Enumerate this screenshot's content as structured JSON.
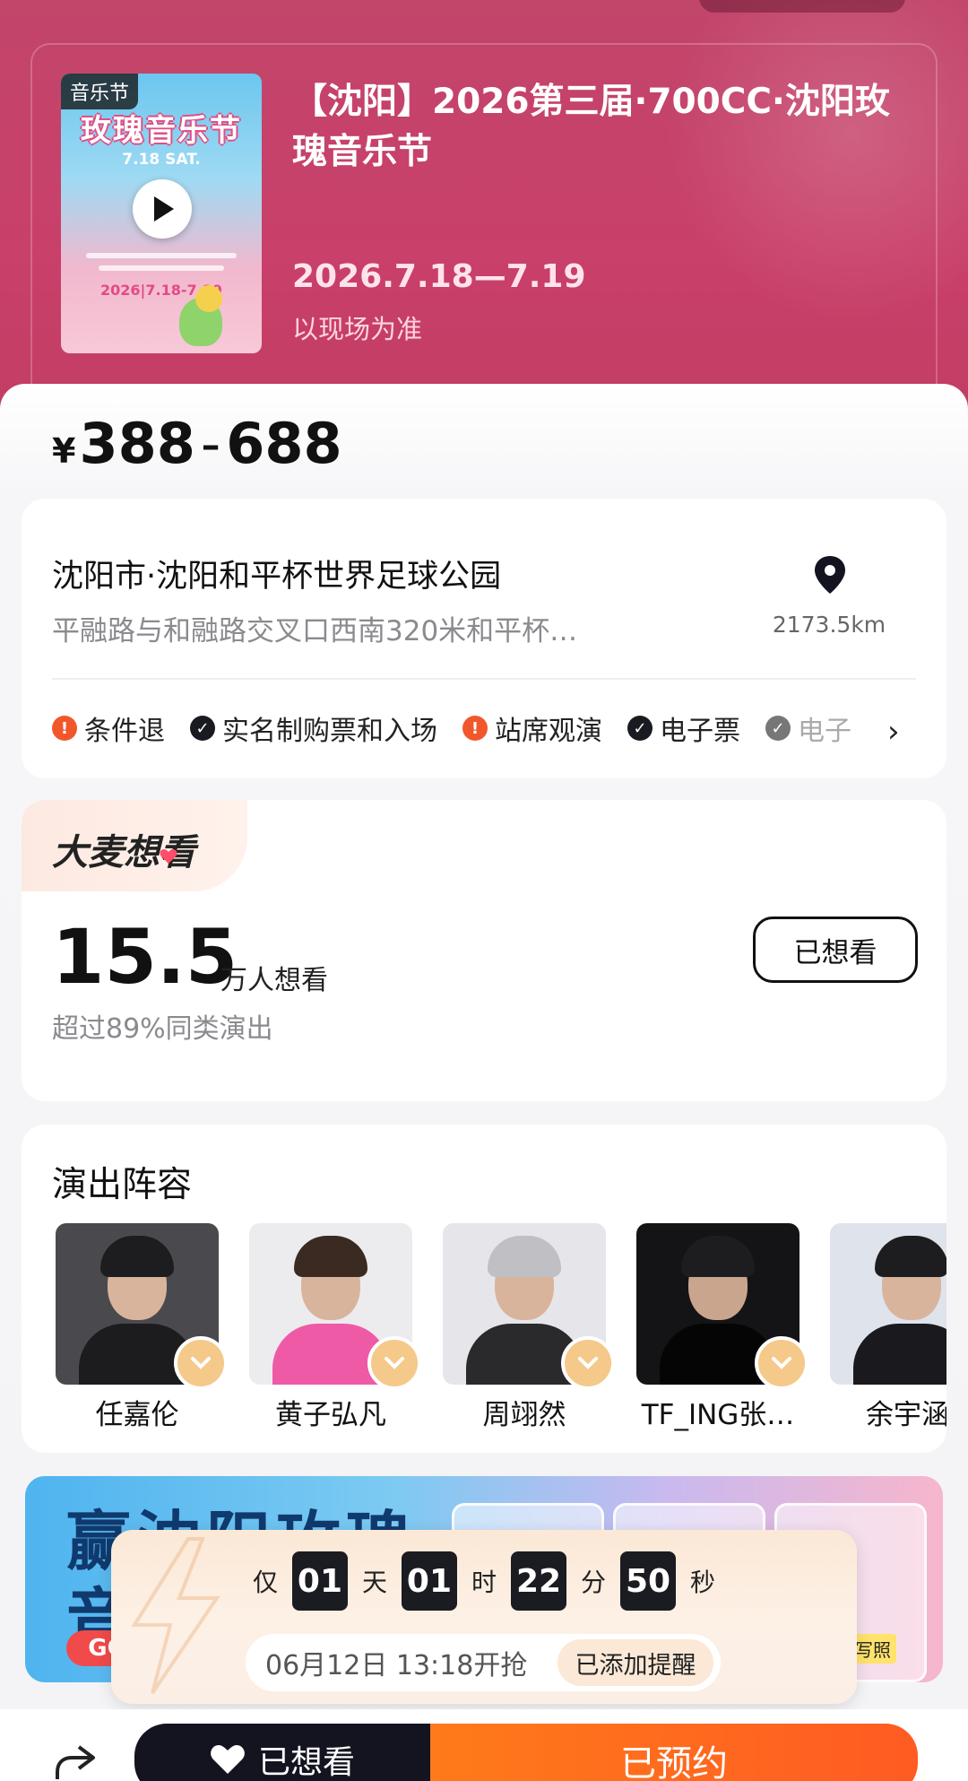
{
  "event": {
    "poster_badge": "音乐节",
    "poster_title": "玫瑰音乐节",
    "poster_date_top": "7.18 SAT.",
    "poster_date_bottom": "2026|7.18-7.19",
    "title": "【沈阳】2026第三届·700CC·沈阳玫瑰音乐节",
    "date": "2026.7.18—7.19",
    "note": "以现场为准"
  },
  "price": {
    "currency": "¥",
    "min": "388",
    "separator": "-",
    "max": "688"
  },
  "venue": {
    "name": "沈阳市·沈阳和平杯世界足球公园",
    "address": "平融路与和融路交叉口西南320米和平杯…",
    "distance": "2173.5km",
    "tags": [
      {
        "label": "条件退",
        "icon": "warning-icon"
      },
      {
        "label": "实名制购票和入场",
        "icon": "check-icon"
      },
      {
        "label": "站席观演",
        "icon": "warning-icon"
      },
      {
        "label": "电子票",
        "icon": "check-icon"
      },
      {
        "label": "电子",
        "icon": "check-icon"
      }
    ],
    "more_icon": "chevron-right-icon"
  },
  "want": {
    "logo": "大麦想看",
    "count": "15.5",
    "unit": "万人想看",
    "sub": "超过89%同类演出",
    "button_label": "已想看"
  },
  "lineup": {
    "title": "演出阵容",
    "artists": [
      {
        "name": "任嘉伦"
      },
      {
        "name": "黄子弘凡"
      },
      {
        "name": "周翊然"
      },
      {
        "name": "TF_ING张…"
      },
      {
        "name": "余宇涵"
      }
    ]
  },
  "banner": {
    "text_line1": "赢沈阳玫瑰",
    "text_line2": "音",
    "go": "GO",
    "tag": "写照"
  },
  "countdown": {
    "prefix": "仅",
    "days": "01",
    "days_unit": "天",
    "hours": "01",
    "hours_unit": "时",
    "minutes": "22",
    "minutes_unit": "分",
    "seconds": "50",
    "seconds_unit": "秒",
    "sale_time": "06月12日 13:18开抢",
    "remind_label": "已添加提醒"
  },
  "bottom": {
    "want_label": "已想看",
    "reserved_label": "已预约"
  },
  "colors": {
    "header": "#c9406a",
    "accent_orange": "#ff5b22",
    "dark": "#141421",
    "warning": "#f2572b"
  }
}
